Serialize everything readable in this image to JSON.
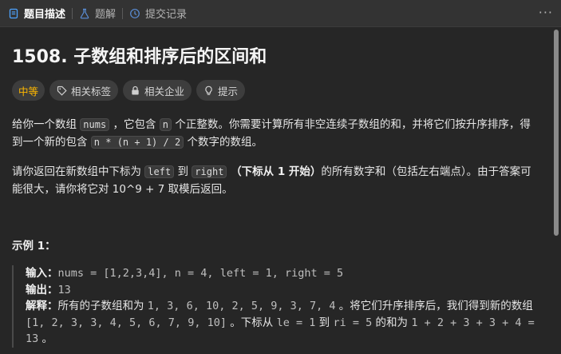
{
  "tabs": {
    "description": "题目描述",
    "solutions": "题解",
    "submissions": "提交记录",
    "more": "···"
  },
  "problem": {
    "title": "1508. 子数组和排序后的区间和",
    "difficulty": "中等",
    "tags": [
      "相关标签",
      "相关企业",
      "提示"
    ]
  },
  "description": {
    "p1_a": "给你一个数组 ",
    "p1_code1": "nums",
    "p1_b": " ，它包含 ",
    "p1_code2": "n",
    "p1_c": " 个正整数。你需要计算所有非空连续子数组的和，并将它们按升序排序，得到一个新的包含 ",
    "p1_code3": "n * (n + 1) / 2",
    "p1_d": " 个数字的数组。",
    "p2_a": "请你返回在新数组中下标为 ",
    "p2_code1": "left",
    "p2_b": " 到 ",
    "p2_code2": "right",
    "p2_strong": " （下标从 1 开始）",
    "p2_c": "的所有数字和（包括左右端点）。由于答案可能很大，请你将它对 10^9 + 7 取模后返回。"
  },
  "example1": {
    "title": "示例 1：",
    "input_label": "输入：",
    "input_value": "nums = [1,2,3,4], n = 4, left = 1, right = 5",
    "output_label": "输出：",
    "output_value": "13",
    "explain_label": "解释：",
    "explain_a": "所有的子数组和为 ",
    "explain_m1": "1, 3, 6, 10, 2, 5, 9, 3, 7, 4",
    "explain_b": " 。将它们升序排序后，我们得到新的数组 ",
    "explain_m2": "[1, 2, 3, 3, 4, 5, 6, 7, 9, 10]",
    "explain_c": " 。下标从 ",
    "explain_m3": "le = 1",
    "explain_d": " 到 ",
    "explain_m4": "ri = 5",
    "explain_e": " 的和为 ",
    "explain_m5": "1 + 2 + 3 + 3 + 4 = 13",
    "explain_f": " 。"
  },
  "colors": {
    "background": "#262626",
    "tabbar": "#333333",
    "difficulty_medium": "#ffb800",
    "tag_bg": "#3d3d3d"
  },
  "icons": {
    "description_tab": "document-icon",
    "solutions_tab": "flask-icon",
    "submissions_tab": "history-clock-icon",
    "tag": "tag-icon",
    "company": "lock-icon",
    "hint": "lightbulb-icon"
  }
}
